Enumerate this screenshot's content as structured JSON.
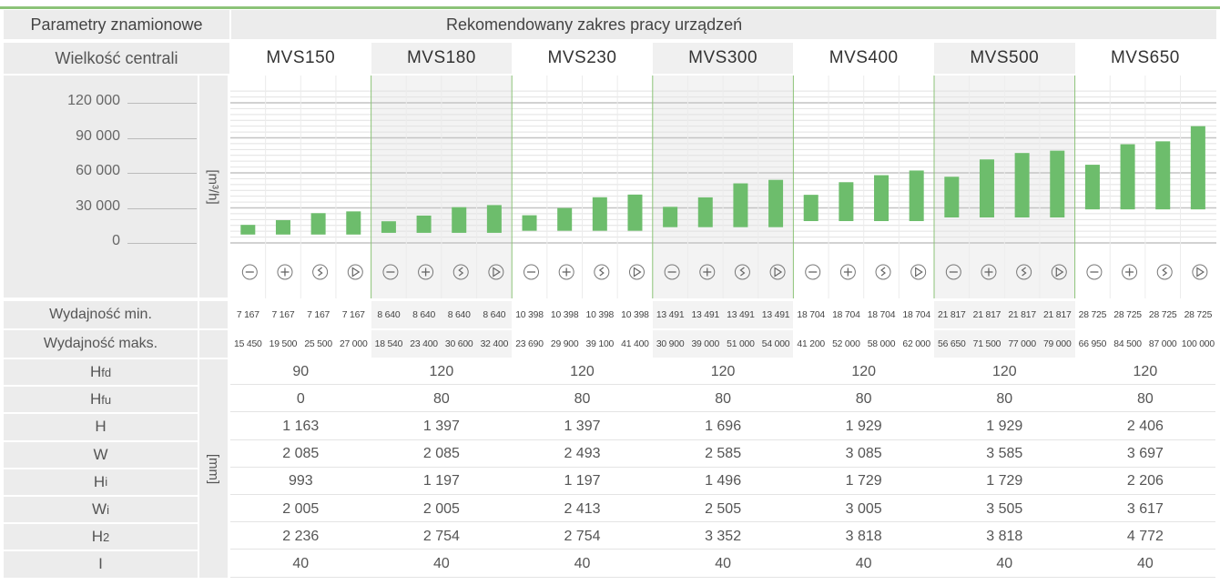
{
  "header": {
    "params_title": "Parametry znamionowe",
    "range_title": "Rekomendowany zakres pracy urządzeń",
    "size_label": "Wielkość centrali"
  },
  "colors": {
    "bar": "#6dbd6c",
    "accent": "#8cc378",
    "label_bg": "#ececec",
    "divider": "#8cc378"
  },
  "models": [
    "MVS150",
    "MVS180",
    "MVS230",
    "MVS300",
    "MVS400",
    "MVS500",
    "MVS650"
  ],
  "fan_modes": [
    "minus-circle-icon",
    "plus-circle-icon",
    "sigma-circle-icon",
    "play-circle-icon"
  ],
  "chart_data": {
    "type": "bar",
    "ylabel": "[m³/h]",
    "ylim": [
      0,
      130000
    ],
    "yticks": [
      "120 000",
      "90 000",
      "60 000",
      "30 000",
      "0"
    ],
    "ytick_values": [
      120000,
      90000,
      60000,
      30000,
      0
    ],
    "grid": true,
    "series": [
      {
        "name": "MVS150",
        "min": [
          7167,
          7167,
          7167,
          7167
        ],
        "max": [
          15450,
          19500,
          25500,
          27000
        ]
      },
      {
        "name": "MVS180",
        "min": [
          8640,
          8640,
          8640,
          8640
        ],
        "max": [
          18540,
          23400,
          30600,
          32400
        ]
      },
      {
        "name": "MVS230",
        "min": [
          10398,
          10398,
          10398,
          10398
        ],
        "max": [
          23690,
          29900,
          39100,
          41400
        ]
      },
      {
        "name": "MVS300",
        "min": [
          13491,
          13491,
          13491,
          13491
        ],
        "max": [
          30900,
          39000,
          51000,
          54000
        ]
      },
      {
        "name": "MVS400",
        "min": [
          18704,
          18704,
          18704,
          18704
        ],
        "max": [
          41200,
          52000,
          58000,
          62000
        ]
      },
      {
        "name": "MVS500",
        "min": [
          21817,
          21817,
          21817,
          21817
        ],
        "max": [
          56650,
          71500,
          77000,
          79000
        ]
      },
      {
        "name": "MVS650",
        "min": [
          28725,
          28725,
          28725,
          28725
        ],
        "max": [
          66950,
          84500,
          87000,
          100000
        ]
      }
    ]
  },
  "table": {
    "dim_unit": "[mm]",
    "flow_rows": [
      {
        "label": "Wydajność min.",
        "values": [
          "7 167",
          "7 167",
          "7 167",
          "7 167",
          "8 640",
          "8 640",
          "8 640",
          "8 640",
          "10 398",
          "10 398",
          "10 398",
          "10 398",
          "13 491",
          "13 491",
          "13 491",
          "13 491",
          "18 704",
          "18 704",
          "18 704",
          "18 704",
          "21 817",
          "21 817",
          "21 817",
          "21 817",
          "28 725",
          "28 725",
          "28 725",
          "28 725"
        ]
      },
      {
        "label": "Wydajność maks.",
        "values": [
          "15 450",
          "19 500",
          "25 500",
          "27 000",
          "18 540",
          "23 400",
          "30 600",
          "32 400",
          "23 690",
          "29 900",
          "39 100",
          "41 400",
          "30 900",
          "39 000",
          "51 000",
          "54 000",
          "41 200",
          "52 000",
          "58 000",
          "62 000",
          "56 650",
          "71 500",
          "77 000",
          "79 000",
          "66 950",
          "84 500",
          "87 000",
          "100 000"
        ]
      }
    ],
    "dim_rows": [
      {
        "label": "H",
        "sub": "fd",
        "values": [
          "90",
          "120",
          "120",
          "120",
          "120",
          "120",
          "120"
        ]
      },
      {
        "label": "H",
        "sub": "fu",
        "values": [
          "0",
          "80",
          "80",
          "80",
          "80",
          "80",
          "80"
        ]
      },
      {
        "label": "H",
        "sub": "",
        "values": [
          "1 163",
          "1 397",
          "1 397",
          "1 696",
          "1 929",
          "1 929",
          "2 406"
        ]
      },
      {
        "label": "W",
        "sub": "",
        "values": [
          "2 085",
          "2 085",
          "2 493",
          "2 585",
          "3 085",
          "3 585",
          "3 697"
        ]
      },
      {
        "label": "H",
        "sub": "i",
        "values": [
          "993",
          "1 197",
          "1 197",
          "1 496",
          "1 729",
          "1 729",
          "2 206"
        ]
      },
      {
        "label": "W",
        "sub": "i",
        "values": [
          "2 005",
          "2 005",
          "2 413",
          "2 505",
          "3 005",
          "3 505",
          "3 617"
        ]
      },
      {
        "label": "H",
        "sub": "2",
        "values": [
          "2 236",
          "2 754",
          "2 754",
          "3 352",
          "3 818",
          "3 818",
          "4 772"
        ]
      },
      {
        "label": "I",
        "sub": "",
        "values": [
          "40",
          "40",
          "40",
          "40",
          "40",
          "40",
          "40"
        ]
      }
    ]
  }
}
